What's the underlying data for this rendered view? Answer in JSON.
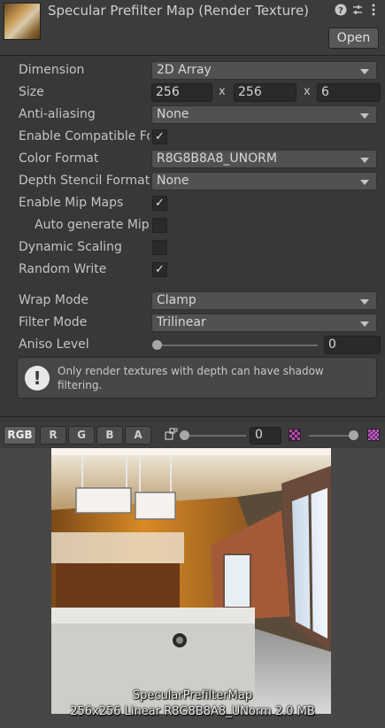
{
  "header": {
    "title": "Specular Prefilter Map (Render Texture)",
    "open_label": "Open",
    "icons": [
      "help-icon",
      "settings-sliders-icon",
      "more-options-icon"
    ]
  },
  "properties": {
    "dimension": {
      "label": "Dimension",
      "value": "2D Array"
    },
    "size": {
      "label": "Size",
      "width": "256",
      "height": "256",
      "depth": "6",
      "sep1": "x",
      "sep2": "x"
    },
    "anti_aliasing": {
      "label": "Anti-aliasing",
      "value": "None"
    },
    "enable_compatible_format": {
      "label": "Enable Compatible Format",
      "checked": true
    },
    "color_format": {
      "label": "Color Format",
      "value": "R8G8B8A8_UNORM"
    },
    "depth_stencil_format": {
      "label": "Depth Stencil Format",
      "value": "None"
    },
    "enable_mip_maps": {
      "label": "Enable Mip Maps",
      "checked": true
    },
    "auto_generate_mip_maps": {
      "label": "Auto generate Mip Maps",
      "checked": false
    },
    "dynamic_scaling": {
      "label": "Dynamic Scaling",
      "checked": false
    },
    "random_write": {
      "label": "Random Write",
      "checked": true
    },
    "wrap_mode": {
      "label": "Wrap Mode",
      "value": "Clamp"
    },
    "filter_mode": {
      "label": "Filter Mode",
      "value": "Trilinear"
    },
    "aniso_level": {
      "label": "Aniso Level",
      "value": "0",
      "level": 0
    }
  },
  "help_box": {
    "icon": "exclamation-icon",
    "text": "Only render textures with depth can have shadow filtering."
  },
  "preview_toolbar": {
    "channels": [
      "RGB",
      "R",
      "G",
      "B",
      "A"
    ],
    "active_channel": "RGB",
    "mip_level": "0",
    "mip_slider_value": 0,
    "exposure_slider_value": 1,
    "icons": [
      "mip-level-icon",
      "small-checker-icon",
      "large-checker-icon"
    ]
  },
  "preview": {
    "caption_name": "SpecularPrefilterMap",
    "caption_info": "256x256 Linear  R8G8B8A8_UNorm  2.0 MB"
  },
  "colors": {
    "background": "#383838",
    "field": "#2a2a2a",
    "dropdown": "#515151",
    "preview_bg": "#474747"
  }
}
